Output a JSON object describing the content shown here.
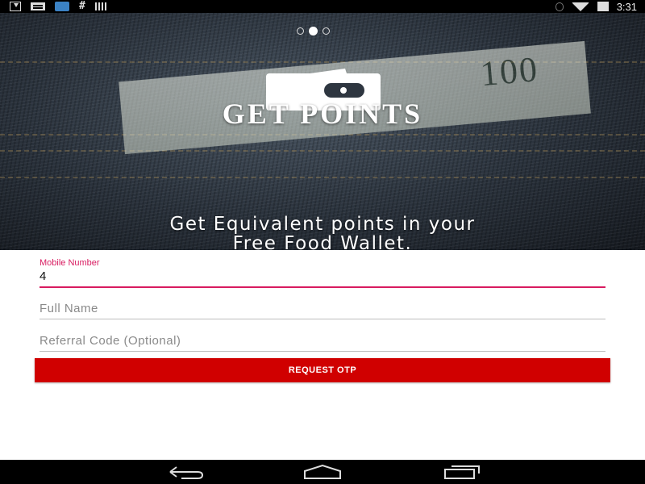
{
  "status_bar": {
    "left_icons": [
      "download-icon",
      "message-icon",
      "app-notification-icon",
      "hash-icon",
      "barcode-icon"
    ],
    "right_icons": [
      "bluetooth-icon",
      "wifi-icon",
      "battery-charging-icon"
    ],
    "time": "3:31"
  },
  "hero": {
    "title": "GET POINTS",
    "subtitle_line1": "Get Equivalent points in your",
    "subtitle_line2": "Free Food Wallet.",
    "banknote_number": "100",
    "page_indicator": {
      "count": 3,
      "active": 1
    },
    "icon": "wallet-icon"
  },
  "form": {
    "mobile": {
      "label": "Mobile Number",
      "value": "4"
    },
    "full_name": {
      "placeholder": "Full Name",
      "value": ""
    },
    "referral": {
      "placeholder": "Referral Code (Optional)",
      "value": ""
    },
    "submit_label": "REQUEST OTP"
  },
  "nav_bar": {
    "buttons": [
      "back-icon",
      "home-icon",
      "recent-apps-icon"
    ]
  },
  "colors": {
    "accent": "#d81b60",
    "button": "#d00000",
    "background": "#ffffff",
    "bars": "#000000"
  }
}
